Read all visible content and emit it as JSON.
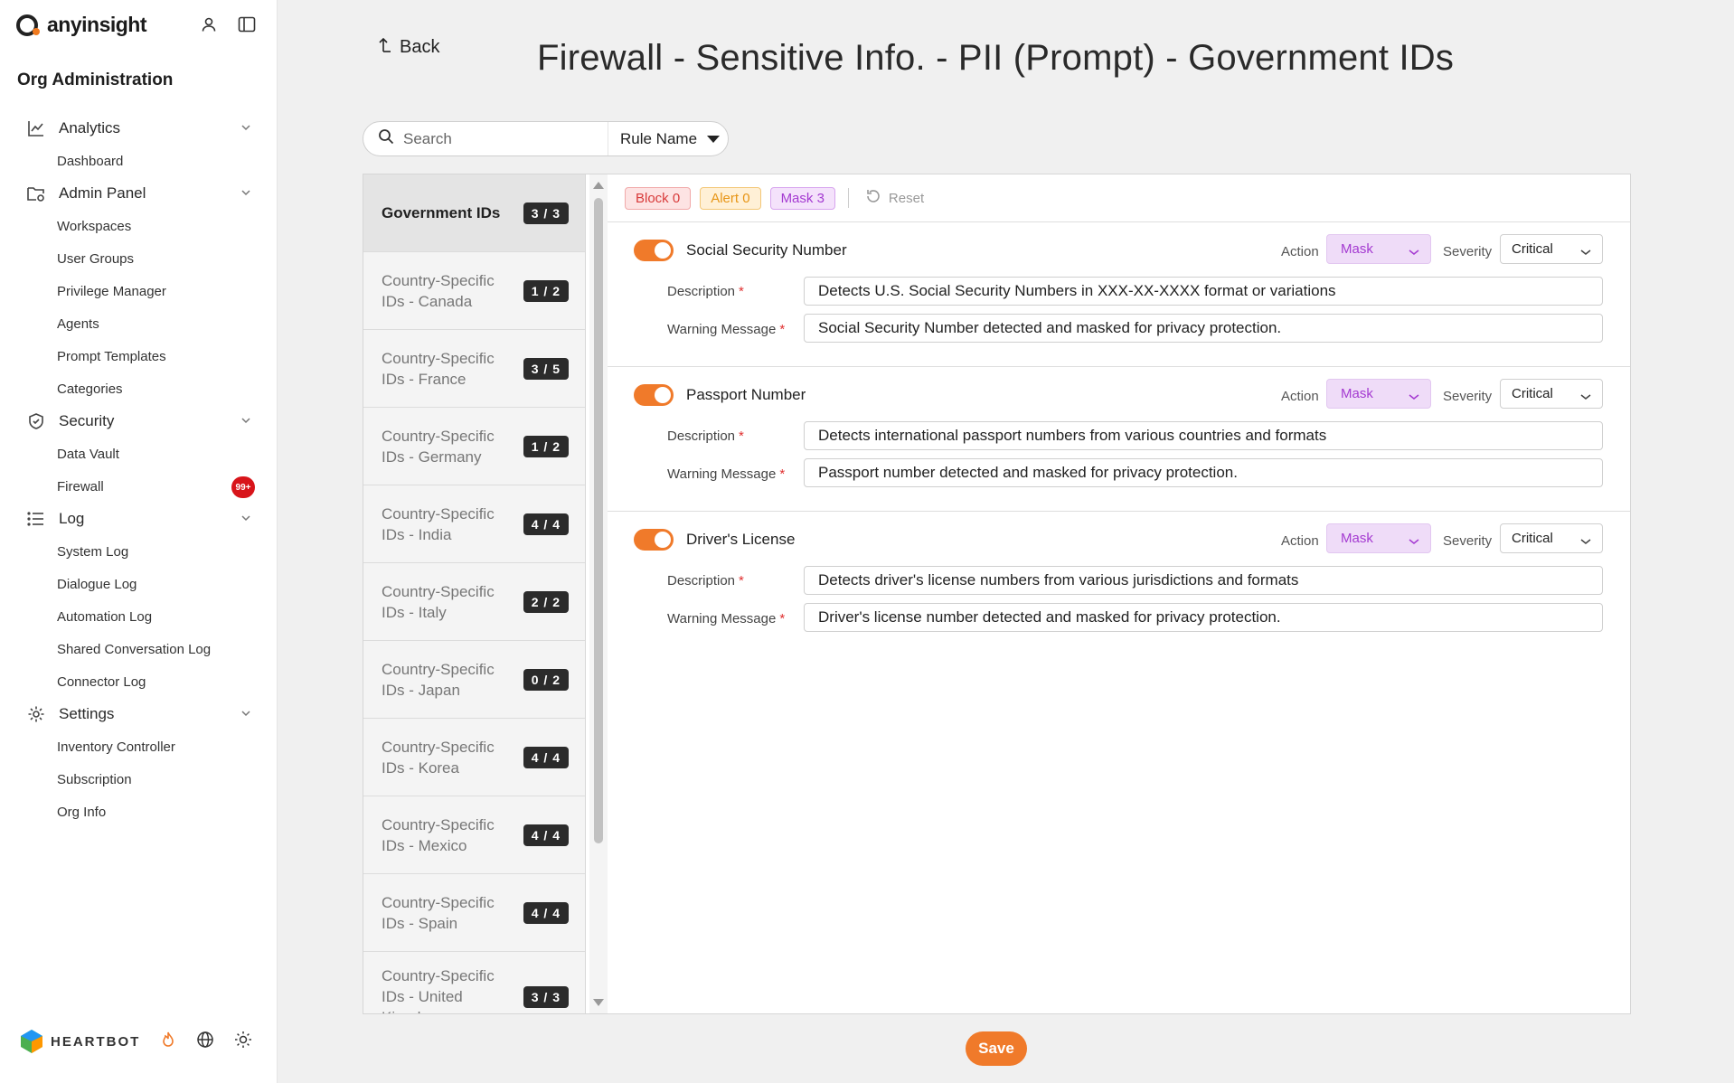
{
  "brand": {
    "name": "anyinsight"
  },
  "sidebar": {
    "org_title": "Org Administration",
    "groups": [
      {
        "label": "Analytics",
        "icon": "chart-line-icon",
        "items": [
          "Dashboard"
        ]
      },
      {
        "label": "Admin Panel",
        "icon": "folder-settings-icon",
        "items": [
          "Workspaces",
          "User Groups",
          "Privilege Manager",
          "Agents",
          "Prompt Templates",
          "Categories"
        ]
      },
      {
        "label": "Security",
        "icon": "shield-check-icon",
        "items": [
          "Data Vault",
          "Firewall"
        ]
      },
      {
        "label": "Log",
        "icon": "list-icon",
        "items": [
          "System Log",
          "Dialogue Log",
          "Automation Log",
          "Shared Conversation Log",
          "Connector Log"
        ]
      },
      {
        "label": "Settings",
        "icon": "gear-icon",
        "items": [
          "Inventory Controller",
          "Subscription",
          "Org Info"
        ]
      }
    ],
    "firewall_badge": "99+",
    "footer": {
      "brand": "HEARTBOT"
    }
  },
  "header": {
    "back_label": "Back",
    "title": "Firewall - Sensitive Info. - PII (Prompt) - Government IDs"
  },
  "search": {
    "placeholder": "Search",
    "filter_selected": "Rule Name"
  },
  "categories": [
    {
      "name": "Government IDs",
      "count": "3 / 3",
      "active": true
    },
    {
      "name": "Country-Specific IDs - Canada",
      "count": "1 / 2"
    },
    {
      "name": "Country-Specific IDs - France",
      "count": "3 / 5"
    },
    {
      "name": "Country-Specific IDs - Germany",
      "count": "1 / 2"
    },
    {
      "name": "Country-Specific IDs - India",
      "count": "4 / 4"
    },
    {
      "name": "Country-Specific IDs - Italy",
      "count": "2 / 2"
    },
    {
      "name": "Country-Specific IDs - Japan",
      "count": "0 / 2"
    },
    {
      "name": "Country-Specific IDs - Korea",
      "count": "4 / 4"
    },
    {
      "name": "Country-Specific IDs - Mexico",
      "count": "4 / 4"
    },
    {
      "name": "Country-Specific IDs - Spain",
      "count": "4 / 4"
    },
    {
      "name": "Country-Specific IDs - United Kingdom",
      "count": "3 / 3"
    }
  ],
  "tags": {
    "block": "Block 0",
    "alert": "Alert 0",
    "mask": "Mask 3",
    "reset": "Reset"
  },
  "labels": {
    "action": "Action",
    "severity": "Severity",
    "description": "Description",
    "warning_message": "Warning Message",
    "required_mark": "*"
  },
  "rules": [
    {
      "name": "Social Security Number",
      "enabled": true,
      "action": "Mask",
      "severity": "Critical",
      "description": "Detects U.S. Social Security Numbers in XXX-XX-XXXX format or variations",
      "warning": "Social Security Number detected and masked for privacy protection."
    },
    {
      "name": "Passport Number",
      "enabled": true,
      "action": "Mask",
      "severity": "Critical",
      "description": "Detects international passport numbers from various countries and formats",
      "warning": "Passport number detected and masked for privacy protection."
    },
    {
      "name": "Driver's License",
      "enabled": true,
      "action": "Mask",
      "severity": "Critical",
      "description": "Detects driver's license numbers from various jurisdictions and formats",
      "warning": "Driver's license number detected and masked for privacy protection."
    }
  ],
  "save_label": "Save",
  "colors": {
    "accent": "#f07a2a",
    "mask": "#a43ad1",
    "block": "#d83a3a",
    "alert": "#e79515",
    "badge_red": "#d8141a"
  }
}
